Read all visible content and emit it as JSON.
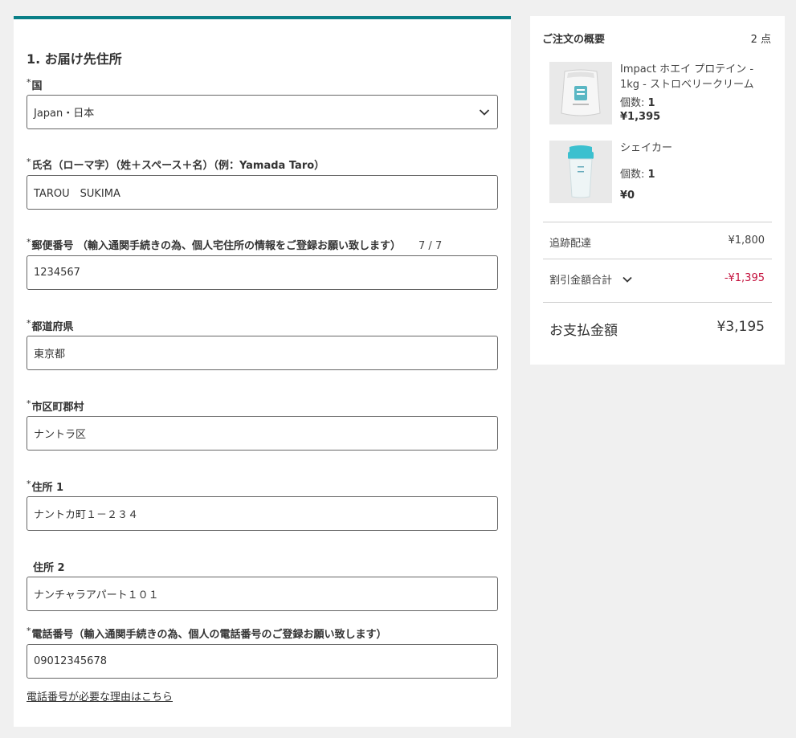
{
  "form": {
    "section_title": "1. お届け先住所",
    "required_mark": "*",
    "country": {
      "label": "国",
      "value": "Japan・日本"
    },
    "name": {
      "label": "氏名（ローマ字）（姓＋スペース＋名）（例：Yamada Taro）",
      "value": "TAROU　SUKIMA"
    },
    "postal": {
      "label": "郵便番号 （輸入通関手続きの為、個人宅住所の情報をご登録お願い致します）",
      "counter": "7 / 7",
      "value": "1234567"
    },
    "prefecture": {
      "label": "都道府県",
      "value": "東京都"
    },
    "city": {
      "label": "市区町郡村",
      "value": "ナントラ区"
    },
    "address1": {
      "label": "住所 1",
      "value": "ナントカ町１－２３４"
    },
    "address2": {
      "label": "住所 2",
      "value": "ナンチャラアパート１０１"
    },
    "phone": {
      "label": "電話番号（輸入通関手続きの為、個人の電話番号のご登録お願い致します）",
      "value": "09012345678"
    },
    "help_link": "電話番号が必要な理由はこちら"
  },
  "summary": {
    "title": "ご注文の概要",
    "item_count": "2 点",
    "items": [
      {
        "name": "Impact ホエイ プロテイン - 1kg - ストロベリークリーム",
        "qty_label": "個数:",
        "qty": "1",
        "price": "¥1,395",
        "image_icon": "protein-bag-icon"
      },
      {
        "name": "シェイカー",
        "qty_label": "個数:",
        "qty": "1",
        "price": "¥0",
        "image_icon": "shaker-bottle-icon"
      }
    ],
    "shipping_label": "追跡配達",
    "shipping_value": "¥1,800",
    "discount_label": "割引金額合計",
    "discount_value": "-¥1,395",
    "total_label": "お支払金額",
    "total_value": "¥3,195"
  },
  "colors": {
    "accent": "#0a7f87",
    "discount": "#c4103c",
    "background": "#f0f0f0"
  }
}
